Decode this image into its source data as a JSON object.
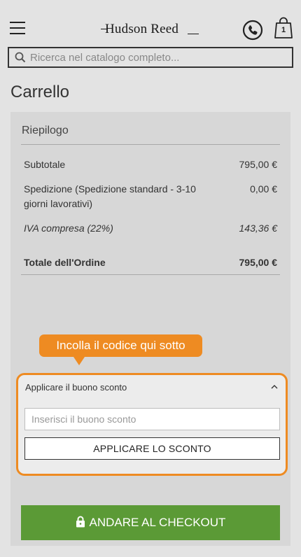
{
  "header": {
    "logo_text": "Hudson Reed",
    "cart_count": "1"
  },
  "search": {
    "placeholder": "Ricerca nel catalogo completo..."
  },
  "page_title": "Carrello",
  "summary": {
    "title": "Riepilogo",
    "rows": [
      {
        "label": "Subtotale",
        "value": "795,00 €"
      },
      {
        "label": "Spedizione (Spedizione standard - 3-10 giorni lavorativi)",
        "value": "0,00 €"
      },
      {
        "label": "IVA compresa (22%)",
        "value": "143,36 €"
      },
      {
        "label": "Totale dell'Ordine",
        "value": "795,00 €"
      }
    ]
  },
  "tooltip": {
    "text": "Incolla il codice qui sotto"
  },
  "discount": {
    "header": "Applicare il buono sconto",
    "input_placeholder": "Inserisci il buono sconto",
    "apply_label": "APPLICARE LO SCONTO"
  },
  "checkout": {
    "label": "ANDARE AL CHECKOUT"
  },
  "colors": {
    "accent_orange": "#ee8b22",
    "checkout_green": "#5b9a36",
    "page_background": "#e3e3e3",
    "panel_background": "#d7d7d7"
  }
}
